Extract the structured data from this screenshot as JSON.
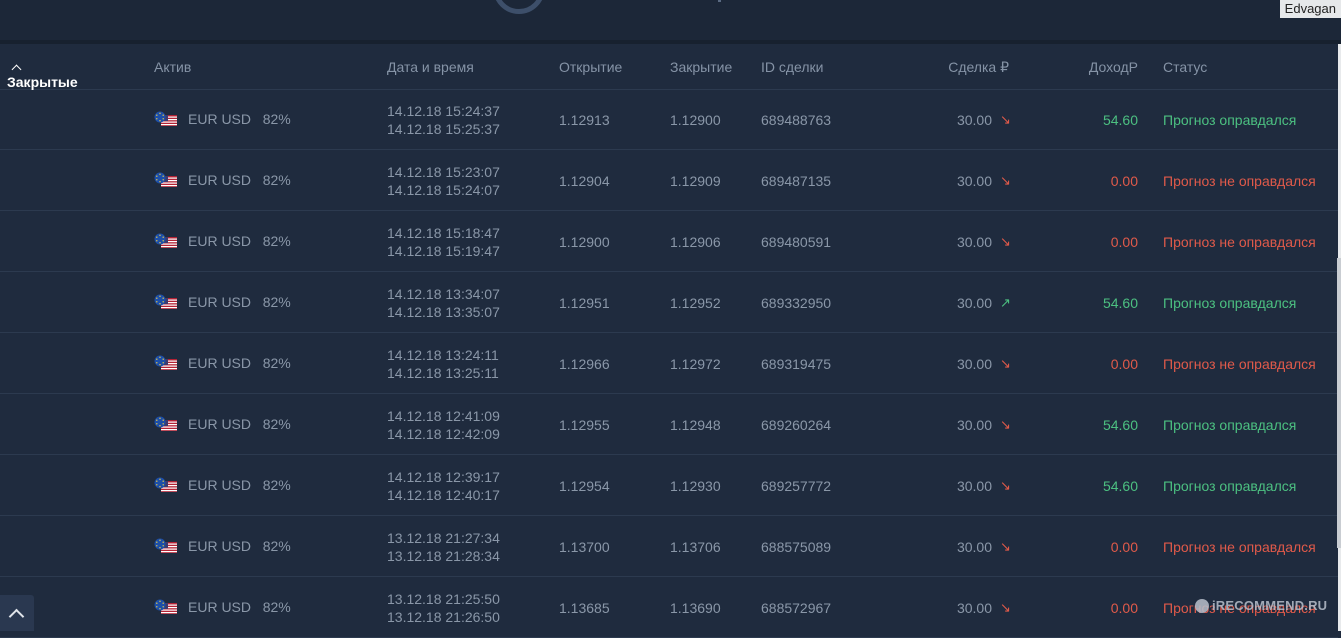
{
  "user": {
    "name": "Edvagan"
  },
  "header": {
    "closed_tab": "Закрытые",
    "asset": "Актив",
    "datetime": "Дата и время",
    "open": "Открытие",
    "close": "Закрытие",
    "deal_id": "ID сделки",
    "amount": "Сделка ₽",
    "income": "ДоходР",
    "status": "Статус"
  },
  "colors": {
    "win": "#4cc081",
    "loss": "#e05a4a",
    "background": "#1f2b3e"
  },
  "rows": [
    {
      "asset": "EUR USD",
      "payout": "82%",
      "start": "14.12.18 15:24:37",
      "end": "14.12.18 15:25:37",
      "open": "1.12913",
      "close": "1.12900",
      "id": "689488763",
      "amount": "30.00",
      "direction": "down",
      "income": "54.60",
      "status": "Прогноз оправдался",
      "result": "win"
    },
    {
      "asset": "EUR USD",
      "payout": "82%",
      "start": "14.12.18 15:23:07",
      "end": "14.12.18 15:24:07",
      "open": "1.12904",
      "close": "1.12909",
      "id": "689487135",
      "amount": "30.00",
      "direction": "down",
      "income": "0.00",
      "status": "Прогноз не оправдался",
      "result": "loss"
    },
    {
      "asset": "EUR USD",
      "payout": "82%",
      "start": "14.12.18 15:18:47",
      "end": "14.12.18 15:19:47",
      "open": "1.12900",
      "close": "1.12906",
      "id": "689480591",
      "amount": "30.00",
      "direction": "down",
      "income": "0.00",
      "status": "Прогноз не оправдался",
      "result": "loss"
    },
    {
      "asset": "EUR USD",
      "payout": "82%",
      "start": "14.12.18 13:34:07",
      "end": "14.12.18 13:35:07",
      "open": "1.12951",
      "close": "1.12952",
      "id": "689332950",
      "amount": "30.00",
      "direction": "up",
      "income": "54.60",
      "status": "Прогноз оправдался",
      "result": "win"
    },
    {
      "asset": "EUR USD",
      "payout": "82%",
      "start": "14.12.18 13:24:11",
      "end": "14.12.18 13:25:11",
      "open": "1.12966",
      "close": "1.12972",
      "id": "689319475",
      "amount": "30.00",
      "direction": "down",
      "income": "0.00",
      "status": "Прогноз не оправдался",
      "result": "loss"
    },
    {
      "asset": "EUR USD",
      "payout": "82%",
      "start": "14.12.18 12:41:09",
      "end": "14.12.18 12:42:09",
      "open": "1.12955",
      "close": "1.12948",
      "id": "689260264",
      "amount": "30.00",
      "direction": "down",
      "income": "54.60",
      "status": "Прогноз оправдался",
      "result": "win"
    },
    {
      "asset": "EUR USD",
      "payout": "82%",
      "start": "14.12.18 12:39:17",
      "end": "14.12.18 12:40:17",
      "open": "1.12954",
      "close": "1.12930",
      "id": "689257772",
      "amount": "30.00",
      "direction": "down",
      "income": "54.60",
      "status": "Прогноз оправдался",
      "result": "win"
    },
    {
      "asset": "EUR USD",
      "payout": "82%",
      "start": "13.12.18 21:27:34",
      "end": "13.12.18 21:28:34",
      "open": "1.13700",
      "close": "1.13706",
      "id": "688575089",
      "amount": "30.00",
      "direction": "down",
      "income": "0.00",
      "status": "Прогноз не оправдался",
      "result": "loss"
    },
    {
      "asset": "EUR USD",
      "payout": "82%",
      "start": "13.12.18 21:25:50",
      "end": "13.12.18 21:26:50",
      "open": "1.13685",
      "close": "1.13690",
      "id": "688572967",
      "amount": "30.00",
      "direction": "down",
      "income": "0.00",
      "status": "Прогноз не оправдался",
      "result": "loss"
    }
  ],
  "watermark": "iRECOMMEND.RU"
}
